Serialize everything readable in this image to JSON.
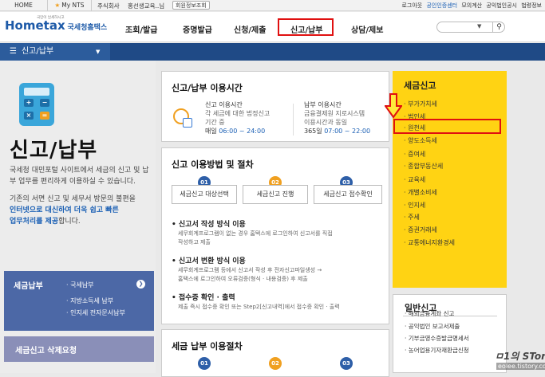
{
  "topbar": {
    "home": "HOME",
    "mynts": "My NTS",
    "user_label": "주식회사",
    "user_name": "홍선생교육..님",
    "member_info": "회원정보조회",
    "right_links": [
      "로그아웃",
      "공인인증센터",
      "모의계산",
      "공익법인공시",
      "법령정보"
    ]
  },
  "header": {
    "logo_small": "국민이 납세하시고",
    "logo_main": "Hometax",
    "logo_sub": "국세청홈택스",
    "nav": [
      "조회/발급",
      "증명발급",
      "신청/제출",
      "신고/납부",
      "상담/제보"
    ],
    "search_placeholder": ""
  },
  "menubar": {
    "label": "신고/납부"
  },
  "left": {
    "title": "신고/납부",
    "desc1": "국세청 대민포털 사이트에서 세금의 신고 및 납부 업무를 편리하게 이용하실 수 있습니다.",
    "desc2_a": "기존의 서면 신고 및 세무서 방문의 불편을",
    "desc2_b": "인터넷으로 대신하여 더욱 쉽고 빠른",
    "desc2_c": "업무처리를 제공",
    "desc2_d": "합니다.",
    "box1_title": "세금납부",
    "box1_items": [
      "국세납부",
      "지방소득세 납부",
      "인지세 전자문서납부"
    ],
    "box2_title": "세금신고 삭제요청"
  },
  "hours": {
    "title": "신고/납부 이용시간",
    "report_title": "신고 이용시간",
    "report_sub1": "각 세금에 대한 법정신고",
    "report_sub2": "기간 중",
    "report_days": "매일",
    "report_time": "06:00 ~ 24:00",
    "pay_title": "납부 이용시간",
    "pay_sub1": "금융결제원 지로시스템",
    "pay_sub2": "이용시간과 동일",
    "pay_days": "365일",
    "pay_time": "07:00 ~ 22:00"
  },
  "procedure": {
    "title": "신고 이용방법 및 절차",
    "steps": [
      {
        "num": "01",
        "label": "세금신고 대상선택"
      },
      {
        "num": "02",
        "label": "세금신고 진행"
      },
      {
        "num": "03",
        "label": "세금신고 접수확인"
      }
    ],
    "items": [
      {
        "title": "신고서 작성 방식 이용",
        "lines": [
          "세무회계프로그램이 없는 경우 홈택스에 로그인하여 신고서를 직접",
          "작성하고 제출"
        ]
      },
      {
        "title": "신고서 변환 방식 이용",
        "lines": [
          "세무회계프로그램 등에서 신고서 작성 후 전자신고파일생성 →",
          "홈택스에 로그인하여 오류검증(형식 · 내용검증) 후 제출"
        ]
      },
      {
        "title": "접수증 확인 · 출력",
        "lines": [
          "제출 즉시 접수증 확인 또는 Step2[신고내역]에서 접수증 확인 · 출력"
        ]
      }
    ]
  },
  "payment": {
    "title": "세금 납부 이용절차",
    "steps": [
      {
        "num": "01"
      },
      {
        "num": "02"
      },
      {
        "num": "03"
      }
    ]
  },
  "right": {
    "title": "세금신고",
    "items": [
      "부가가치세",
      "법인세",
      "원천세",
      "양도소득세",
      "증여세",
      "종합부동산세",
      "교육세",
      "개별소비세",
      "인지세",
      "주세",
      "증권거래세",
      "교통에너지환경세"
    ],
    "box2_title": "일반신고",
    "box2_items": [
      "해외금융계좌 신고",
      "공익법인 보고서제출",
      "기부금영수증발급명세서",
      "농어업용기자재환급신청"
    ]
  },
  "watermark": {
    "line1": "ㅁ1의 STory",
    "line2": "eolee.tistory.com"
  },
  "colors": {
    "brand_blue": "#1d5aa8",
    "nav_bar": "#1f4a86",
    "highlight_red": "#e01010",
    "yellow_panel": "#ffd313",
    "step1": "#2e5fa8",
    "step2": "#f0a020",
    "step3": "#2e5fa8"
  }
}
